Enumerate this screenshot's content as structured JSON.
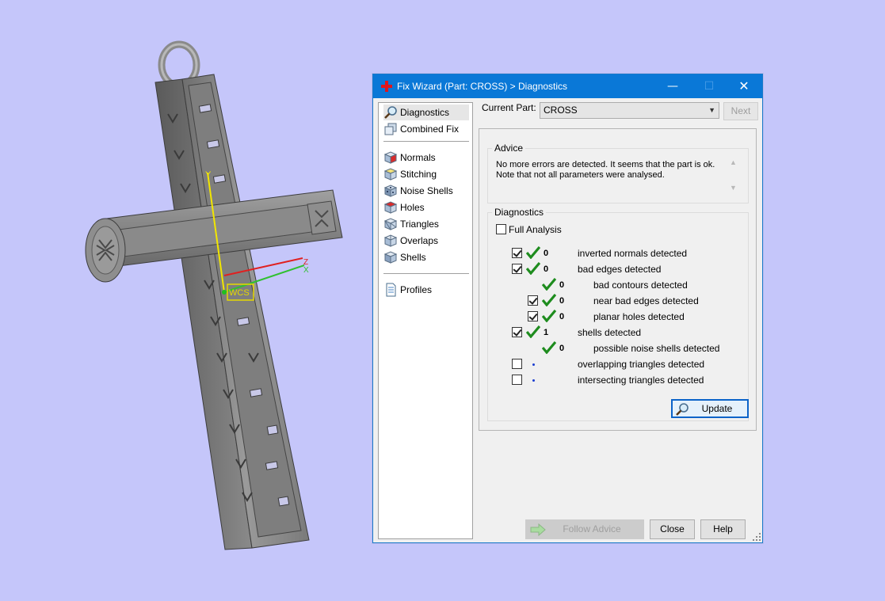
{
  "viewport": {
    "axis_labels": {
      "y": "Y",
      "z": "Z",
      "x": "X"
    },
    "wcs_label": "WCS"
  },
  "dialog": {
    "title": "Fix Wizard (Part: CROSS) > Diagnostics",
    "window_controls": {
      "minimize": "—",
      "maximize": "☐",
      "close": "✕"
    },
    "nav": {
      "group1": [
        {
          "label": "Diagnostics",
          "icon": "magnifier-icon",
          "selected": true
        },
        {
          "label": "Combined Fix",
          "icon": "combined-fix-icon"
        }
      ],
      "group2": [
        {
          "label": "Normals",
          "icon": "normals-cube-icon"
        },
        {
          "label": "Stitching",
          "icon": "stitching-cube-icon"
        },
        {
          "label": "Noise Shells",
          "icon": "noise-shells-icon"
        },
        {
          "label": "Holes",
          "icon": "holes-cube-icon"
        },
        {
          "label": "Triangles",
          "icon": "triangles-cube-icon"
        },
        {
          "label": "Overlaps",
          "icon": "overlaps-cube-icon"
        },
        {
          "label": "Shells",
          "icon": "shells-cube-icon"
        }
      ],
      "group3": [
        {
          "label": "Profiles",
          "icon": "document-icon"
        }
      ]
    },
    "current_part_label": "Current Part:",
    "current_part_value": "CROSS",
    "next_label": "Next",
    "advice": {
      "title": "Advice",
      "text": "No more errors are detected. It seems that the part is ok. Note that not all parameters were analysed."
    },
    "diagnostics": {
      "title": "Diagnostics",
      "full_analysis_label": "Full Analysis",
      "items": [
        {
          "count": "0",
          "label": "inverted normals detected"
        },
        {
          "count": "0",
          "label": "bad edges detected"
        },
        {
          "count": "0",
          "label": "bad contours detected"
        },
        {
          "count": "0",
          "label": "near bad edges detected"
        },
        {
          "count": "0",
          "label": "planar holes detected"
        },
        {
          "count": "1",
          "label": "shells detected"
        },
        {
          "count": "0",
          "label": "possible noise shells detected"
        },
        {
          "count": "",
          "label": "overlapping triangles detected"
        },
        {
          "count": "",
          "label": "intersecting triangles detected"
        }
      ],
      "update_label": "Update"
    },
    "footer": {
      "follow_advice_label": "Follow Advice",
      "close_label": "Close",
      "help_label": "Help"
    },
    "colors": {
      "title_bar": "#0a78d7",
      "check_green": "#1e8c1e",
      "background": "#c5c6fa"
    }
  }
}
